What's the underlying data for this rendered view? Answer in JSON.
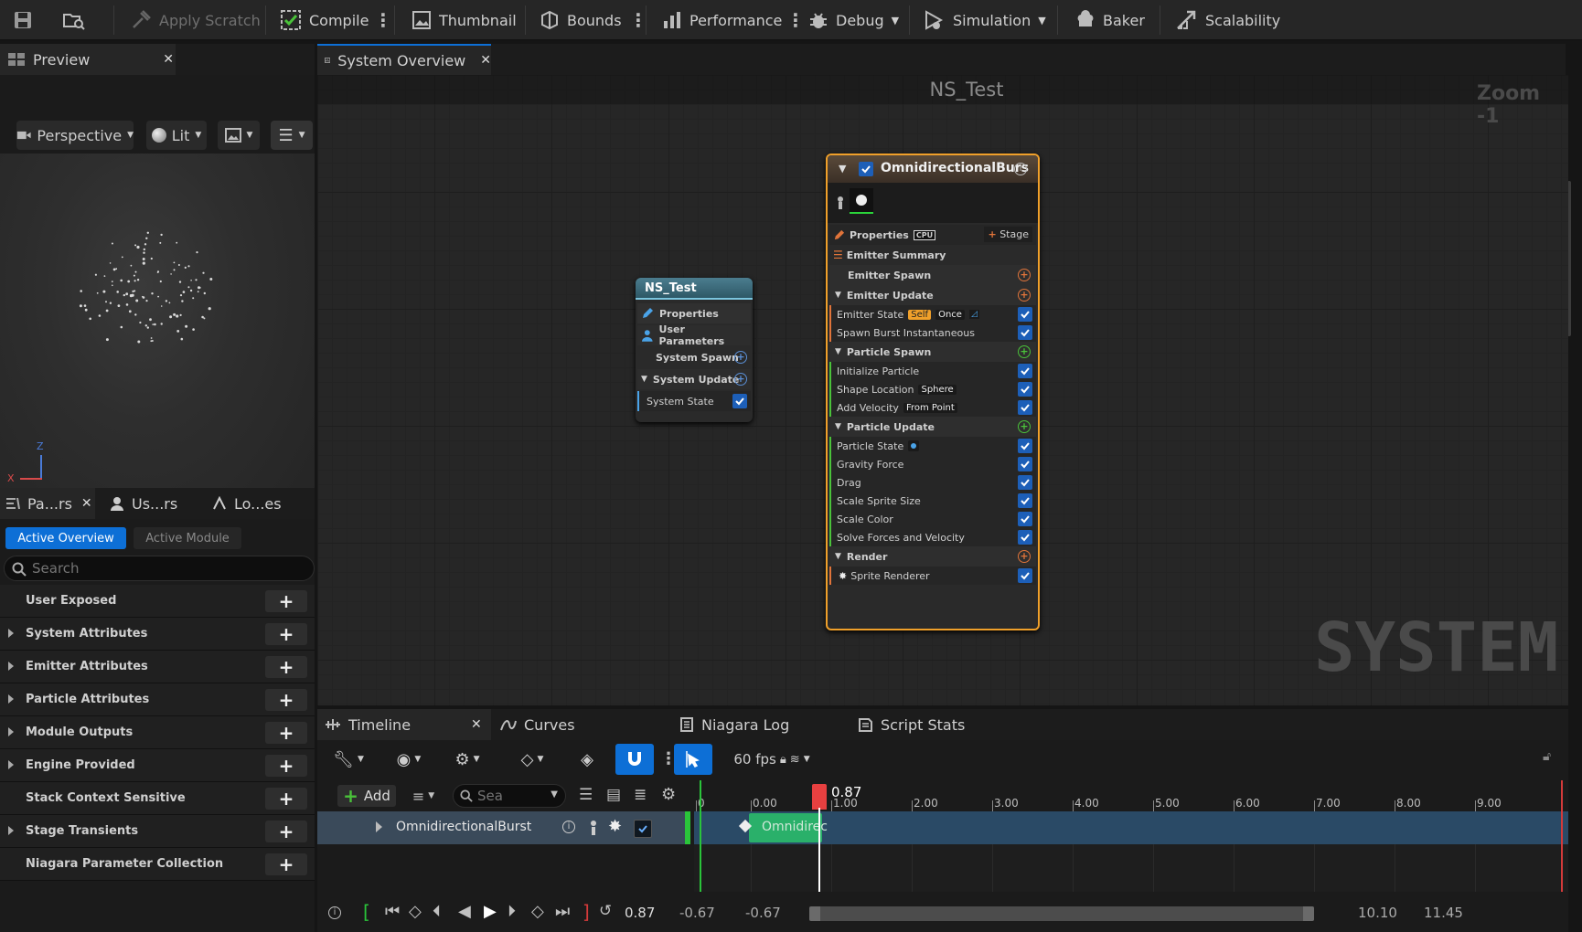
{
  "toolbar": {
    "apply_scratch": "Apply Scratch",
    "compile": "Compile",
    "thumbnail": "Thumbnail",
    "bounds": "Bounds",
    "performance": "Performance",
    "debug": "Debug",
    "simulation": "Simulation",
    "baker": "Baker",
    "scalability": "Scalability"
  },
  "preview": {
    "tab_title": "Preview",
    "perspective": "Perspective",
    "lit": "Lit",
    "axis_z": "Z",
    "axis_x": "X"
  },
  "params_tabs": {
    "tab1": "Pa...rs",
    "tab2": "Us...rs",
    "tab3": "Lo...es"
  },
  "params": {
    "active_overview": "Active Overview",
    "active_module": "Active Module",
    "search_placeholder": "Search",
    "rows": [
      {
        "label": "User Exposed",
        "expandable": false
      },
      {
        "label": "System Attributes",
        "expandable": true
      },
      {
        "label": "Emitter Attributes",
        "expandable": true
      },
      {
        "label": "Particle Attributes",
        "expandable": true
      },
      {
        "label": "Module Outputs",
        "expandable": true
      },
      {
        "label": "Engine Provided",
        "expandable": true
      },
      {
        "label": "Stack Context Sensitive",
        "expandable": false
      },
      {
        "label": "Stage Transients",
        "expandable": true
      },
      {
        "label": "Niagara Parameter Collection",
        "expandable": false
      }
    ]
  },
  "graph": {
    "tab_title": "System Overview",
    "system_name": "NS_Test",
    "zoom": "Zoom -1",
    "watermark": "SYSTEM",
    "system_node": {
      "title": "NS_Test",
      "properties": "Properties",
      "user_parameters": "User Parameters",
      "system_spawn": "System Spawn",
      "system_update": "System Update",
      "system_state": "System State"
    },
    "emitter_node": {
      "title": "OmnidirectionalBurs",
      "properties": "Properties",
      "cpu": "CPU",
      "stage": "Stage",
      "emitter_summary": "Emitter Summary",
      "emitter_spawn": "Emitter Spawn",
      "emitter_update": "Emitter Update",
      "emitter_state": "Emitter State",
      "emitter_state_self": "Self",
      "emitter_state_once": "Once",
      "spawn_burst": "Spawn Burst Instantaneous",
      "particle_spawn": "Particle Spawn",
      "initialize_particle": "Initialize Particle",
      "shape_location": "Shape Location",
      "shape_location_value": "Sphere",
      "add_velocity": "Add Velocity",
      "add_velocity_value": "From Point",
      "particle_update": "Particle Update",
      "particle_state": "Particle State",
      "gravity_force": "Gravity Force",
      "drag": "Drag",
      "scale_sprite_size": "Scale Sprite Size",
      "scale_color": "Scale Color",
      "solve_forces": "Solve Forces and Velocity",
      "render": "Render",
      "sprite_renderer": "Sprite Renderer"
    }
  },
  "timeline": {
    "tabs": {
      "timeline": "Timeline",
      "curves": "Curves",
      "niagara_log": "Niagara Log",
      "script_stats": "Script Stats"
    },
    "fps": "60 fps",
    "add": "Add",
    "search_placeholder": "Sea",
    "track_name": "OmnidirectionalBurst",
    "clip_label": "Omnidirec",
    "playhead_value": "0.87",
    "ruler": [
      "0",
      "0.00",
      "1.00",
      "2.00",
      "3.00",
      "4.00",
      "5.00",
      "6.00",
      "7.00",
      "8.00",
      "9.00"
    ],
    "current_time": "0.87",
    "range_start": "-0.67",
    "view_start": "-0.67",
    "view_end": "10.10",
    "range_end": "11.45"
  }
}
